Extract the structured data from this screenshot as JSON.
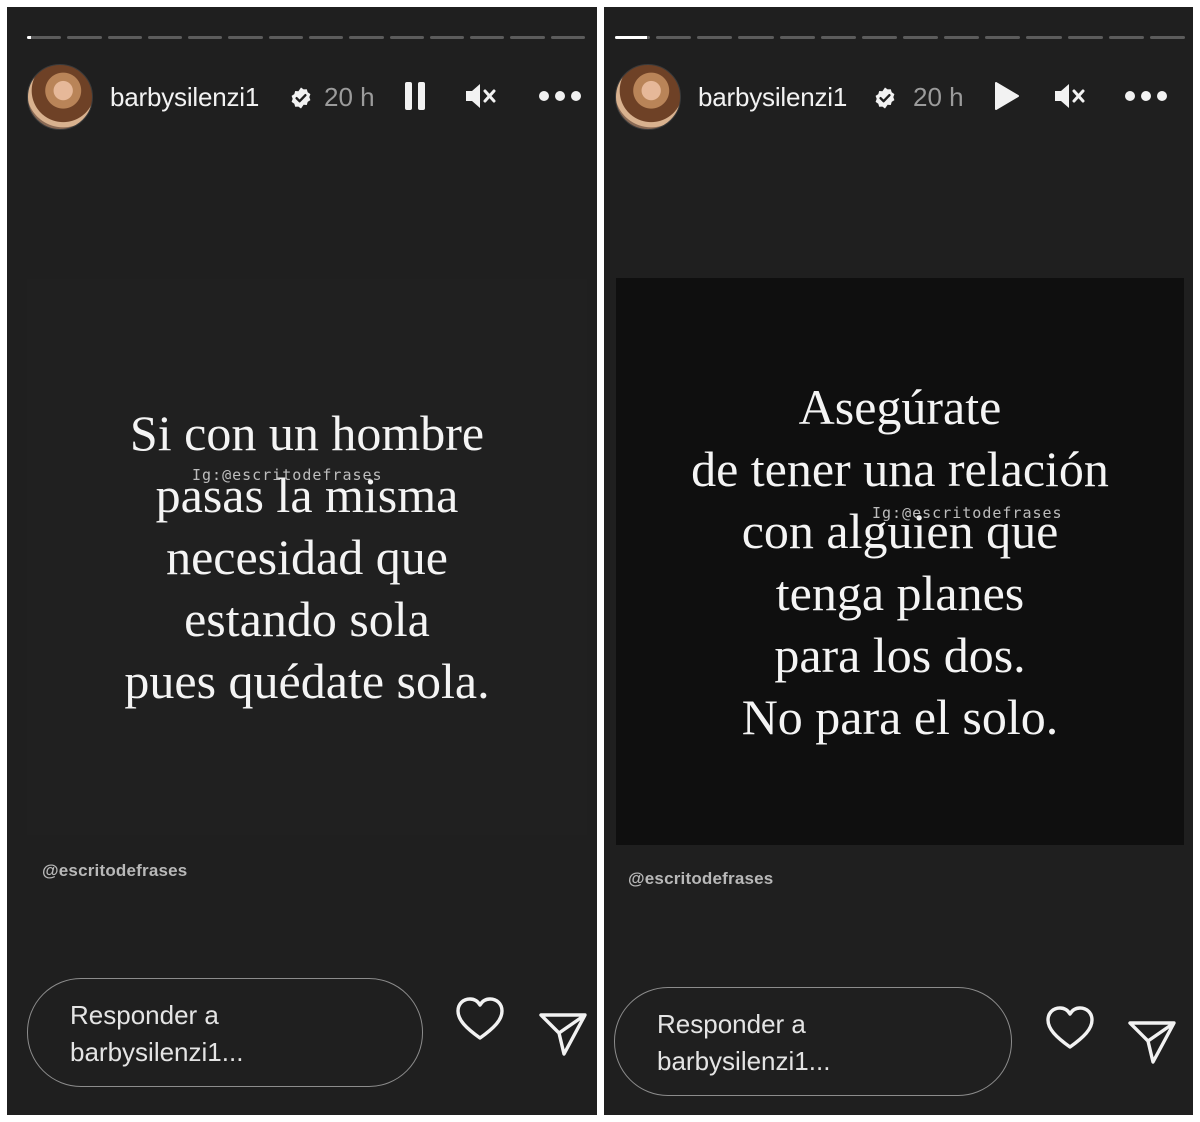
{
  "stories": [
    {
      "username": "barbysilenzi1",
      "time": "20 h",
      "playback_state": "playing",
      "progress": {
        "segments": 14,
        "active_index": 0,
        "active_fraction": 0.12
      },
      "quote_lines": [
        "Si con un hombre",
        "pasas la misma",
        "necesidad que",
        "estando sola",
        "pues quédate sola."
      ],
      "watermark": "Ig:@escritodefrases",
      "credit": "@escritodefrases",
      "reply_line1": "Responder a",
      "reply_line2": "barbysilenzi1..."
    },
    {
      "username": "barbysilenzi1",
      "time": "20 h",
      "playback_state": "paused",
      "progress": {
        "segments": 14,
        "active_index": 0,
        "active_fraction": 0.9
      },
      "quote_lines": [
        "Asegúrate",
        "de tener una relación",
        "con alguien que",
        "tenga planes",
        "para los dos.",
        "No para el solo."
      ],
      "watermark": "Ig:@escritodefrases",
      "credit": "@escritodefrases",
      "reply_line1": "Responder a",
      "reply_line2": "barbysilenzi1..."
    }
  ],
  "icons": {
    "verified": "verified-badge-icon",
    "pause": "pause-icon",
    "play": "play-icon",
    "mute": "speaker-muted-icon",
    "more": "more-options-icon",
    "like": "heart-icon",
    "share": "send-icon"
  },
  "colors": {
    "story_background": "#1f1f1f",
    "text_primary": "#f2f2f2",
    "text_muted": "#9b9b9b",
    "progress_track": "#5c5c5c",
    "progress_fill": "#ffffff"
  }
}
